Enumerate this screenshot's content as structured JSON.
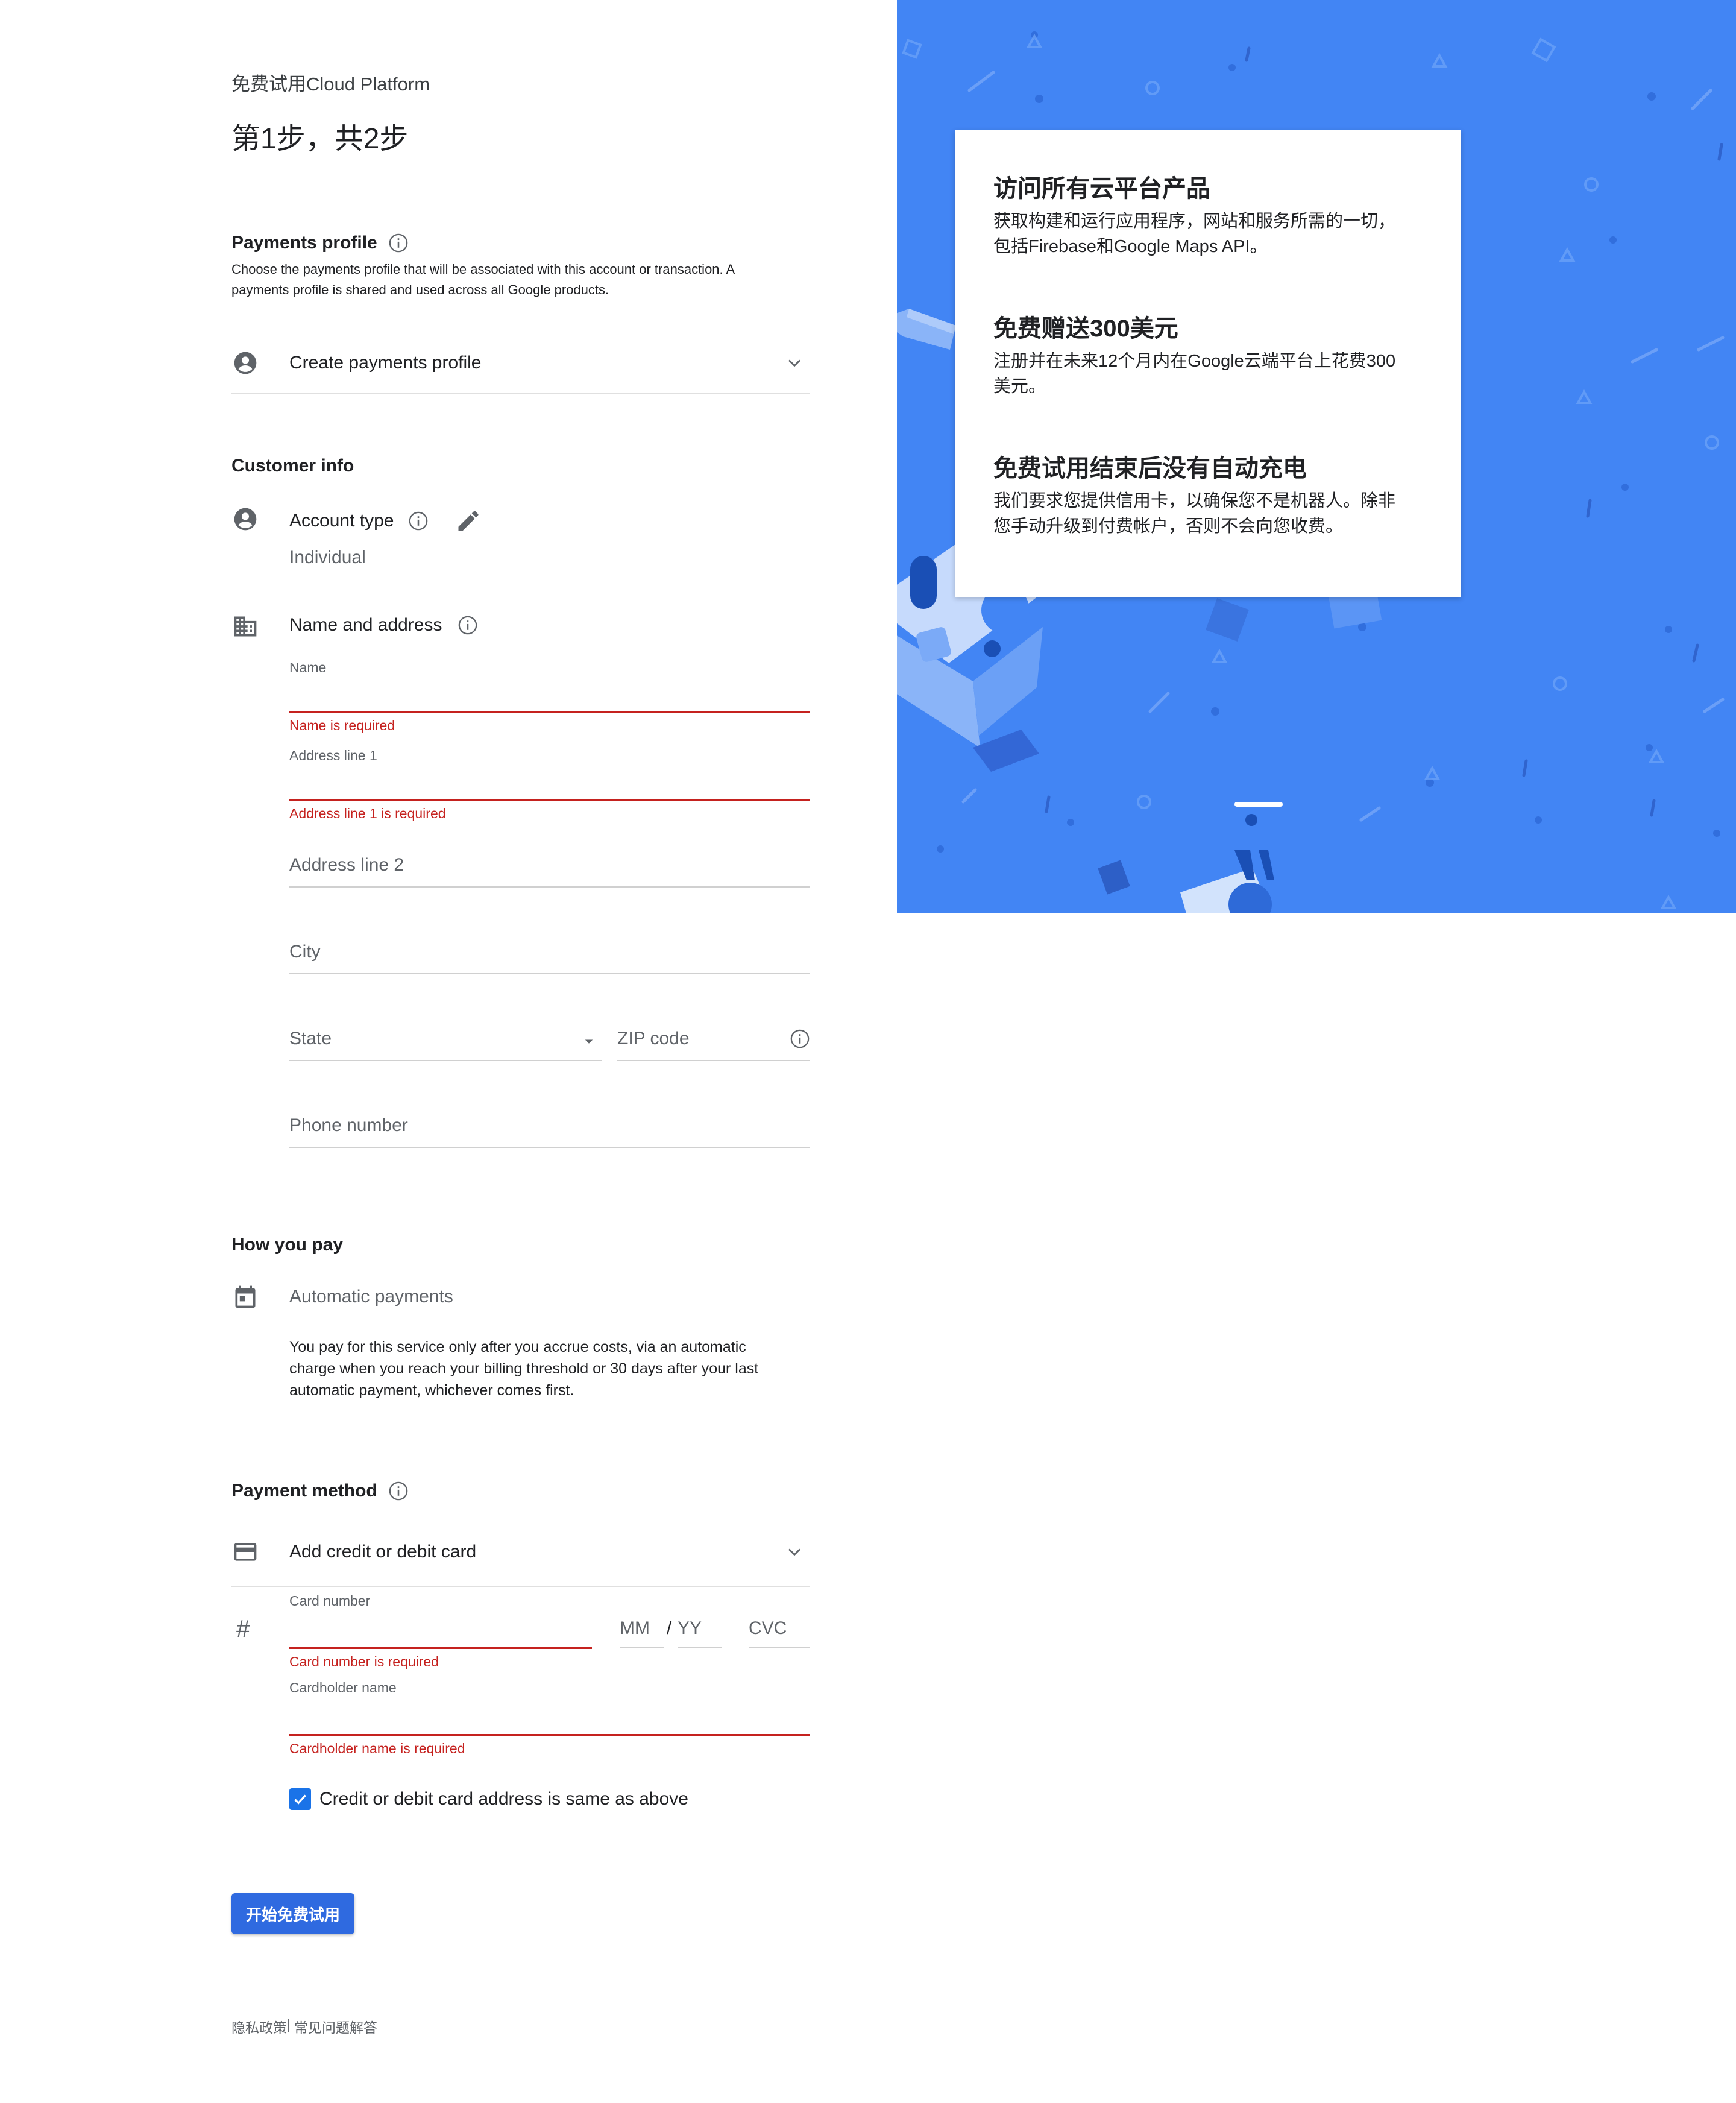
{
  "header": {
    "subtitle": "免费试用Cloud Platform",
    "step": "第1步，共2步"
  },
  "payments_profile": {
    "title": "Payments profile",
    "description_line1": "Choose the payments profile that will be associated with this account or transaction. A",
    "description_line2": "payments profile is shared and used across all Google products.",
    "select_label": "Create payments profile"
  },
  "customer_info": {
    "title": "Customer info",
    "account_type_label": "Account type",
    "account_type_value": "Individual",
    "name_address_label": "Name and address",
    "name_label": "Name",
    "name_error": "Name is required",
    "address1_label": "Address line 1",
    "address1_error": "Address line 1 is required",
    "address2_placeholder": "Address line 2",
    "city_placeholder": "City",
    "state_placeholder": "State",
    "zip_placeholder": "ZIP code",
    "phone_placeholder": "Phone number"
  },
  "how_you_pay": {
    "title": "How you pay",
    "method": "Automatic payments",
    "text_line1": "You pay for this service only after you accrue costs, via an automatic",
    "text_line2": "charge when you reach your billing threshold or 30 days after your last",
    "text_line3": "automatic payment, whichever comes first."
  },
  "payment_method": {
    "title": "Payment method",
    "select_label": "Add credit or debit card",
    "hash_symbol": "#",
    "card_number_label": "Card number",
    "card_number_error": "Card number is required",
    "mm_placeholder": "MM",
    "slash": "/",
    "yy_placeholder": "YY",
    "cvc_placeholder": "CVC",
    "cardholder_label": "Cardholder name",
    "cardholder_error": "Cardholder name is required",
    "same_address_label": "Credit or debit card address is same as above",
    "same_address_checked": true
  },
  "submit_button": "开始免费试用",
  "footer": {
    "privacy": "隐私政策",
    "separator": "|",
    "faq": "常见问题解答"
  },
  "promo": {
    "heading1": "访问所有云平台产品",
    "text1_line1": "获取构建和运行应用程序，网站和服务所需的一切，",
    "text1_line2": "包括Firebase和Google Maps API。",
    "heading2": "免费赠送300美元",
    "text2_line1": "注册并在未来12个月内在Google云端平台上花费300",
    "text2_line2": "美元。",
    "heading3": "免费试用结束后没有自动充电",
    "text3_line1": "我们要求您提供信用卡，以确保您不是机器人。除非",
    "text3_line2": "您手动升级到付费帐户，否则不会向您收费。"
  },
  "colors": {
    "panel_blue": "#4285f4",
    "primary_button": "#2f6ae0",
    "error_red": "#c5221f",
    "checkbox_blue": "#1a73e8"
  }
}
